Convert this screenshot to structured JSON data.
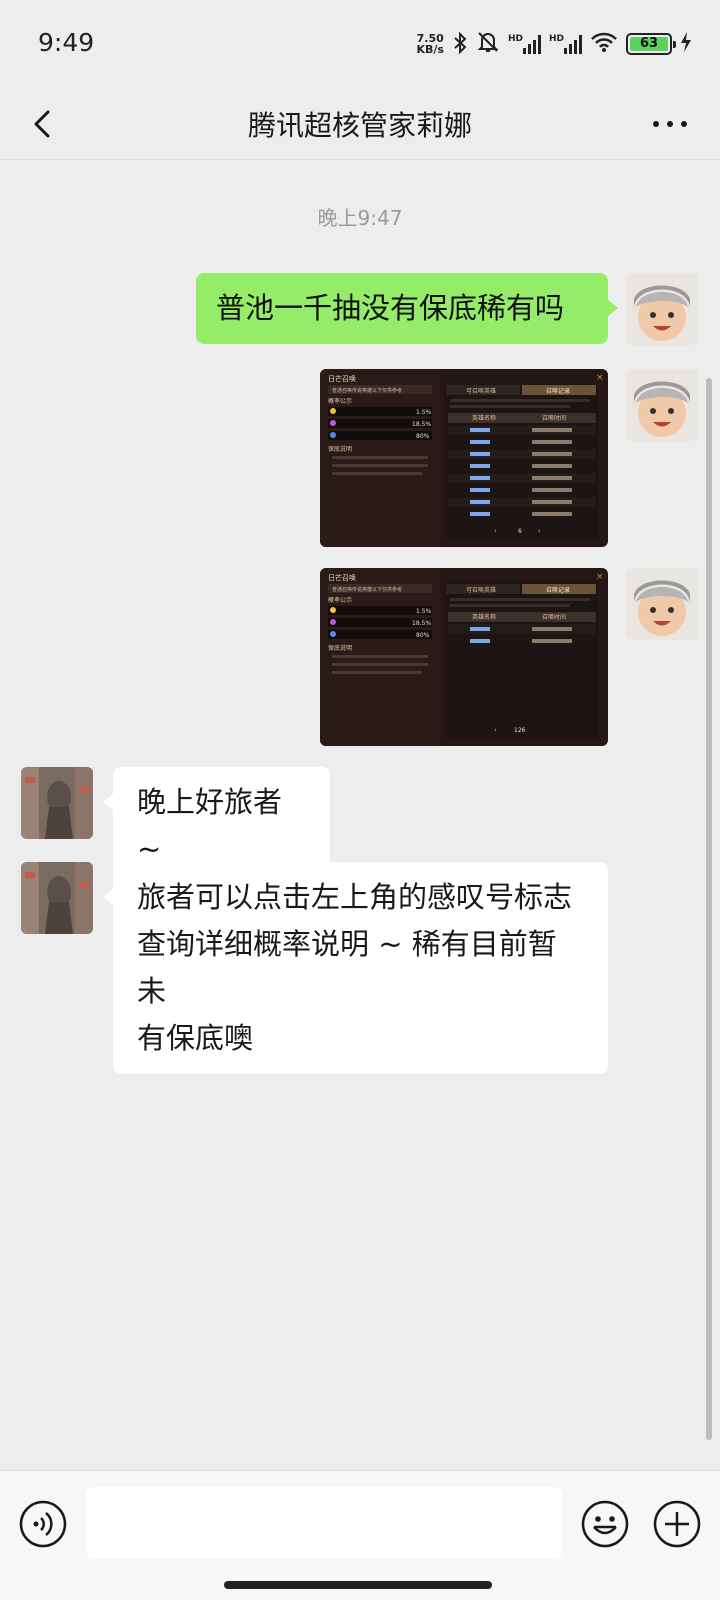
{
  "status_bar": {
    "time": "9:49",
    "net_speed_value": "7.50",
    "net_speed_unit": "KB/s",
    "hd_label_1": "HD",
    "hd_label_2": "HD",
    "battery_level": "63",
    "icons": [
      "bluetooth-icon",
      "mute-bell-icon",
      "signal-icon",
      "signal-icon",
      "wifi-icon",
      "battery-icon",
      "charging-icon"
    ]
  },
  "header": {
    "title": "腾讯超核管家莉娜",
    "back_icon": "chevron-left-icon",
    "more_icon": "more-dots-icon"
  },
  "chat": {
    "timestamp": "晚上9:47",
    "messages": [
      {
        "from": "me",
        "type": "text",
        "text": "普池一千抽没有保底稀有吗"
      },
      {
        "from": "me",
        "type": "image",
        "description_name": "summon-history-screenshot-1"
      },
      {
        "from": "me",
        "type": "image",
        "description_name": "summon-history-screenshot-2"
      },
      {
        "from": "other",
        "type": "text",
        "text": "晚上好旅者 ~"
      },
      {
        "from": "other",
        "type": "text",
        "line1": "旅者可以点击左上角的感叹号标志",
        "line2": "查询详细概率说明 ~ 稀有目前暂未",
        "line3": "有保底噢"
      }
    ]
  },
  "screenshot_1": {
    "title": "日芒召唤",
    "notice": "普通召唤传说英雄以下仅供参考",
    "section_prob": "概率公示",
    "legendary_rate": "1.5%",
    "epic_rate": "18.5%",
    "rare_rate": "80%",
    "section_guarantee": "保底说明",
    "tab_heroes": "可召唤英雄",
    "tab_records": "召唤记录",
    "col_hero": "英雄名称",
    "col_time": "召唤时间",
    "page": "6"
  },
  "screenshot_2": {
    "title": "日芒召唤",
    "notice": "普通召唤传说英雄以下仅供参考",
    "section_prob": "概率公示",
    "legendary_rate": "1.5%",
    "epic_rate": "18.5%",
    "rare_rate": "80%",
    "section_guarantee": "保底说明",
    "tab_heroes": "可召唤英雄",
    "tab_records": "召唤记录",
    "col_hero": "英雄名称",
    "col_time": "召唤时间",
    "page": "126"
  },
  "input_bar": {
    "placeholder": "",
    "voice_icon": "voice-icon",
    "emoji_icon": "emoji-icon",
    "plus_icon": "plus-icon"
  }
}
